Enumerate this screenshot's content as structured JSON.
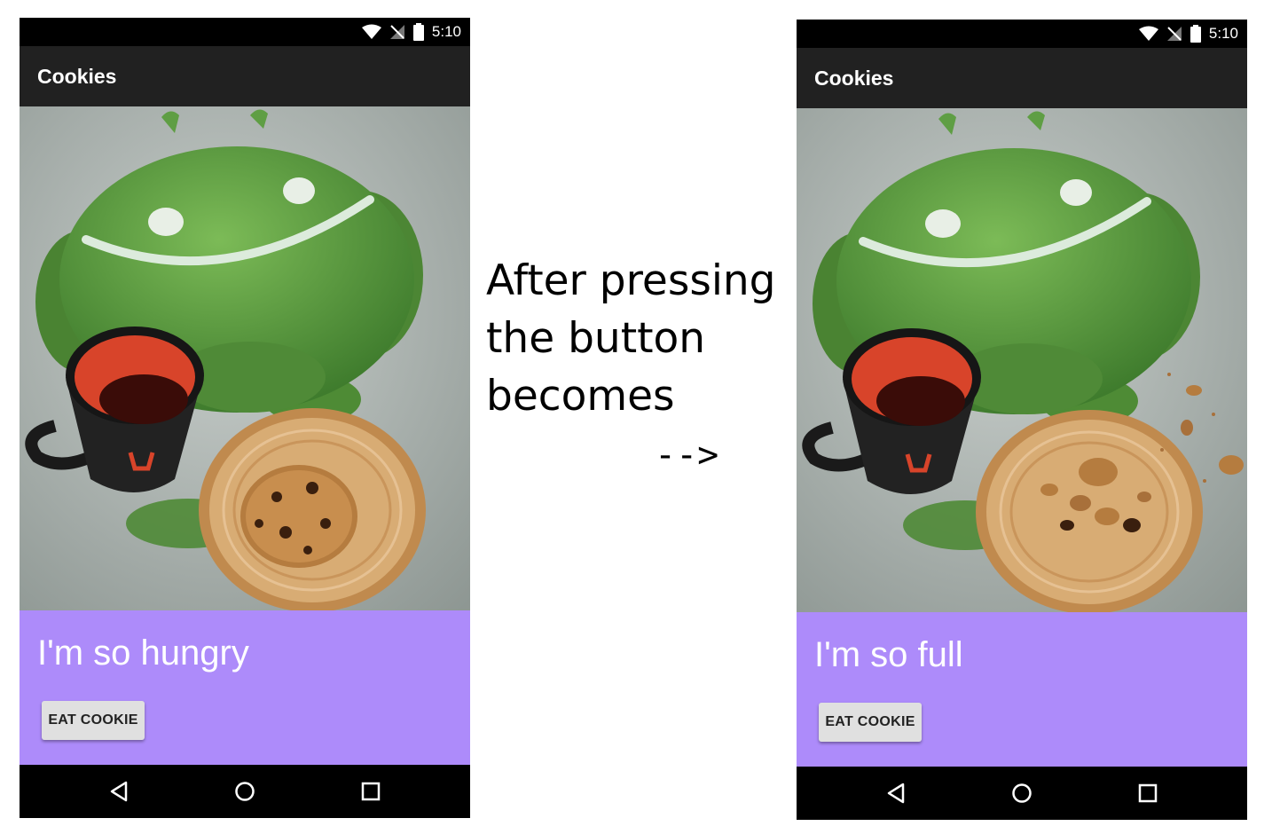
{
  "caption": {
    "line1": "After pressing",
    "line2": "the button",
    "line3": "becomes",
    "arrow": "-->"
  },
  "before": {
    "status_bar": {
      "time": "5:10"
    },
    "app_bar": {
      "title": "Cookies"
    },
    "photo": {
      "description_icon": "android-plush-with-whole-cookie"
    },
    "status_text": "I'm so hungry",
    "button_label": "EAT COOKIE"
  },
  "after": {
    "status_bar": {
      "time": "5:10"
    },
    "app_bar": {
      "title": "Cookies"
    },
    "photo": {
      "description_icon": "android-plush-with-cookie-crumbs"
    },
    "status_text": "I'm so full",
    "button_label": "EAT COOKIE"
  },
  "colors": {
    "status_panel": "#ad8bfa",
    "app_bar": "#212121",
    "button": "#e0e0e0",
    "plush_green": "#5f9e44",
    "mug_red": "#d8442a",
    "plate": "#d4a46a"
  }
}
